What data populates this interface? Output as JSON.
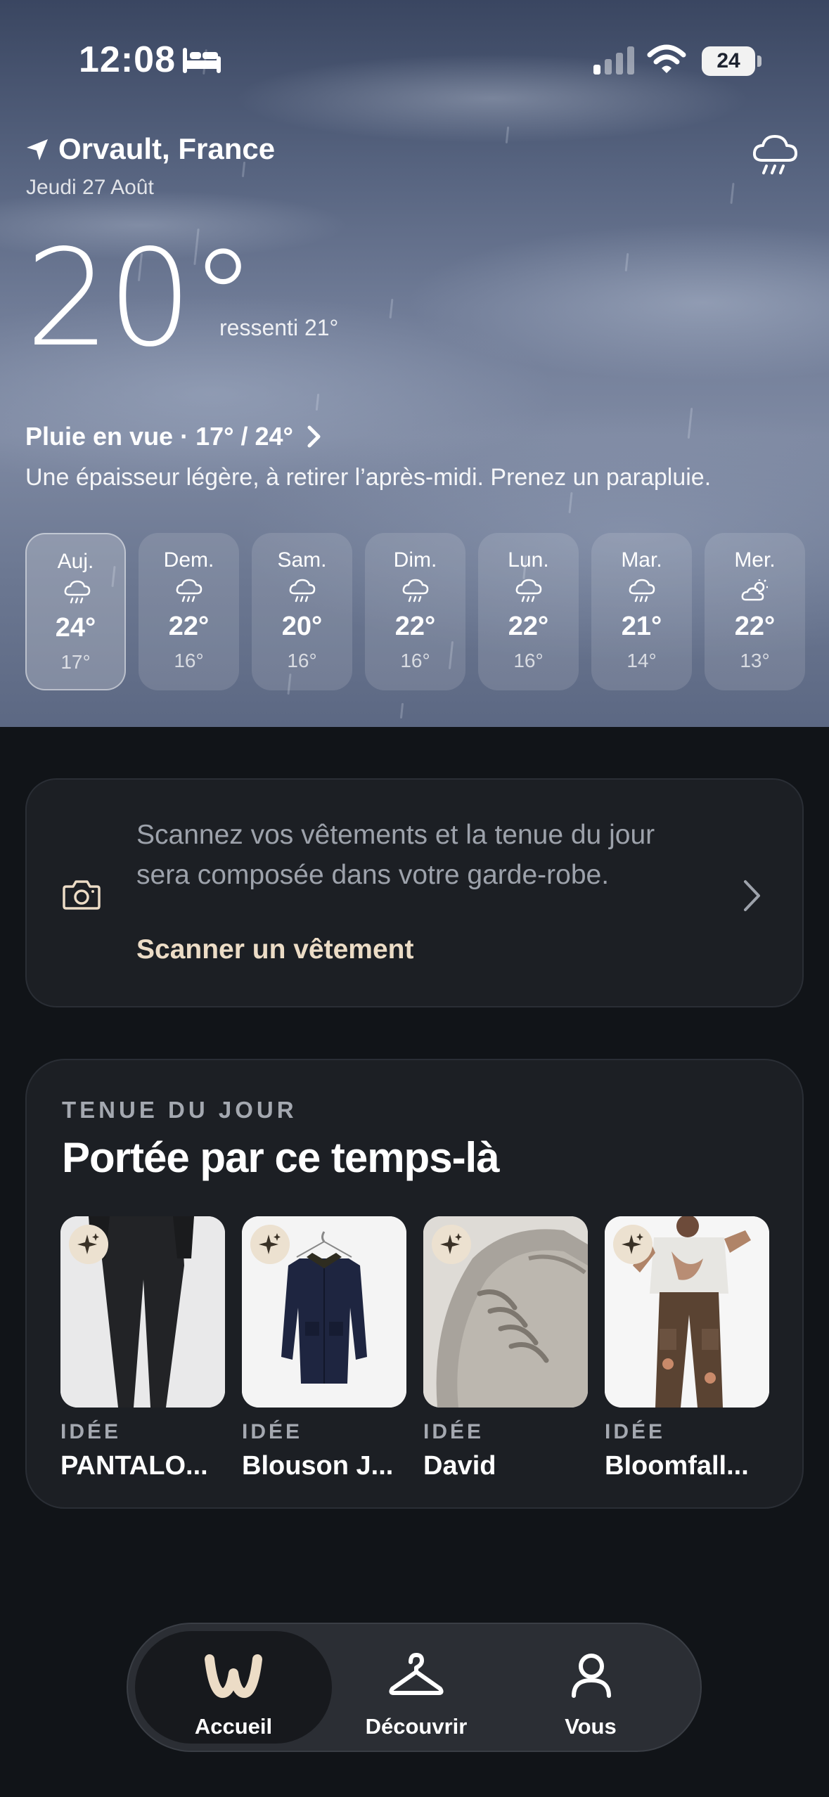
{
  "status_bar": {
    "time": "12:08",
    "battery": "24",
    "icons": [
      "bed-icon",
      "signal-icon",
      "wifi-icon",
      "battery-icon"
    ]
  },
  "weather": {
    "location": "Orvault, France",
    "date": "Jeudi 27 Août",
    "temperature": "20°",
    "feels_like": "ressenti 21°",
    "forecast_title": "Pluie en vue · 17° / 24°",
    "forecast_desc": "Une épaisseur légère, à retirer l’après-midi. Prenez un parapluie.",
    "condition_icon": "cloud-rain-icon",
    "days": [
      {
        "label": "Auj.",
        "icon": "rain",
        "max": "24°",
        "min": "17°",
        "selected": true
      },
      {
        "label": "Dem.",
        "icon": "rain",
        "max": "22°",
        "min": "16°",
        "selected": false
      },
      {
        "label": "Sam.",
        "icon": "rain",
        "max": "20°",
        "min": "16°",
        "selected": false
      },
      {
        "label": "Dim.",
        "icon": "rain",
        "max": "22°",
        "min": "16°",
        "selected": false
      },
      {
        "label": "Lun.",
        "icon": "rain",
        "max": "22°",
        "min": "16°",
        "selected": false
      },
      {
        "label": "Mar.",
        "icon": "rain",
        "max": "21°",
        "min": "14°",
        "selected": false
      },
      {
        "label": "Mer.",
        "icon": "partly-sunny",
        "max": "22°",
        "min": "13°",
        "selected": false
      }
    ]
  },
  "scan_card": {
    "text": "Scannez vos vêtements et la tenue du jour sera composée dans votre garde-robe.",
    "cta": "Scanner un vêtement"
  },
  "outfit": {
    "eyebrow": "TENUE DU JOUR",
    "title": "Portée par ce temps-là",
    "items": [
      {
        "tag": "IDÉE",
        "name": "PANTALO..."
      },
      {
        "tag": "IDÉE",
        "name": "Blouson J..."
      },
      {
        "tag": "IDÉE",
        "name": "David"
      },
      {
        "tag": "IDÉE",
        "name": "Bloomfall..."
      }
    ]
  },
  "tabbar": {
    "tabs": [
      {
        "label": "Accueil",
        "icon": "w-logo-icon",
        "active": true
      },
      {
        "label": "Découvrir",
        "icon": "hanger-icon",
        "active": false
      },
      {
        "label": "Vous",
        "icon": "person-icon",
        "active": false
      }
    ]
  },
  "colors": {
    "accent": "#ecdcc6",
    "background": "#111418",
    "card": "#1c1f24"
  }
}
